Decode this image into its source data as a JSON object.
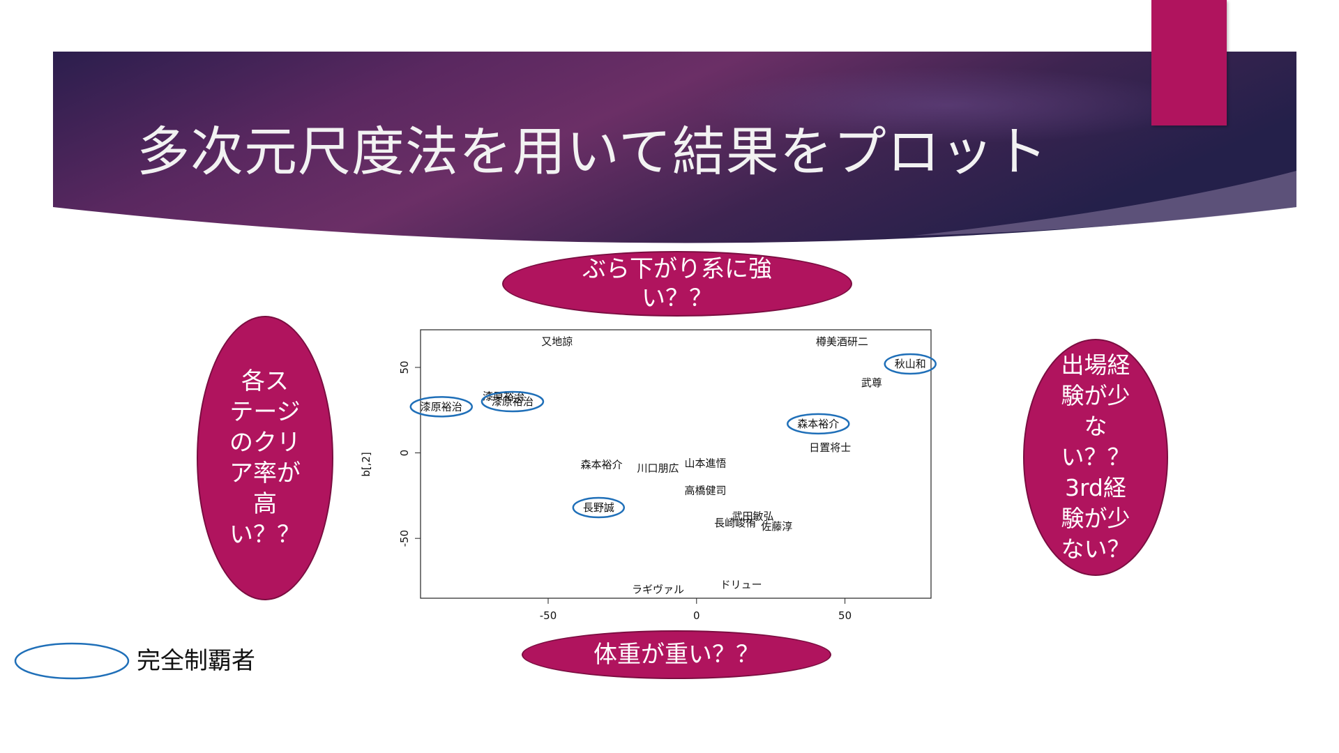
{
  "slide": {
    "title": "多次元尺度法を用いて結果をプロット",
    "colors": {
      "banner_dark": "#2a1f4a",
      "banner_mid": "#5c2a5e",
      "accent": "#b0145e",
      "legend_ring": "#1f6fb8"
    }
  },
  "bubbles": {
    "top": "ぶら下がり系に強\nい？？",
    "left": "各ス\nテージ\nのクリ\nア率が\n高\nい？？",
    "right": "出場経\n験が少\nな\nい？？\n3rd経\n験が少\nない？",
    "bottom": "体重が重い？？"
  },
  "legend": {
    "label": "完全制覇者"
  },
  "chart_data": {
    "type": "scatter",
    "xlabel": "",
    "ylabel": "b[,2]",
    "xlim": [
      -93,
      79
    ],
    "ylim": [
      -85,
      72
    ],
    "x_ticks": [
      "-50",
      "0",
      "50"
    ],
    "y_ticks": [
      "-50",
      "0",
      "50"
    ],
    "points": [
      {
        "label": "又地諒",
        "x": -47,
        "y": 65,
        "champion": false
      },
      {
        "label": "樽美酒研二",
        "x": 49,
        "y": 65,
        "champion": false
      },
      {
        "label": "秋山和",
        "x": 72,
        "y": 52,
        "champion": true
      },
      {
        "label": "武尊",
        "x": 59,
        "y": 41,
        "champion": false
      },
      {
        "label": "漆原裕治",
        "x": -86,
        "y": 27,
        "champion": true
      },
      {
        "label": "漆原裕治",
        "x": -65,
        "y": 33,
        "champion": false
      },
      {
        "label": "漆原裕治",
        "x": -62,
        "y": 30,
        "champion": true
      },
      {
        "label": "森本裕介",
        "x": 41,
        "y": 17,
        "champion": true
      },
      {
        "label": "日置将士",
        "x": 45,
        "y": 3,
        "champion": false
      },
      {
        "label": "森本裕介",
        "x": -32,
        "y": -7,
        "champion": false
      },
      {
        "label": "川口朋広",
        "x": -13,
        "y": -9,
        "champion": false
      },
      {
        "label": "山本進悟",
        "x": 3,
        "y": -6,
        "champion": false
      },
      {
        "label": "高橋健司",
        "x": 3,
        "y": -22,
        "champion": false
      },
      {
        "label": "長野誠",
        "x": -33,
        "y": -32,
        "champion": true
      },
      {
        "label": "武田敏弘",
        "x": 19,
        "y": -37,
        "champion": false
      },
      {
        "label": "長崎峻侑",
        "x": 13,
        "y": -41,
        "champion": false
      },
      {
        "label": "佐藤淳",
        "x": 27,
        "y": -43,
        "champion": false
      },
      {
        "label": "ドリュー",
        "x": 15,
        "y": -77,
        "champion": false
      },
      {
        "label": "ラギヴァル",
        "x": -13,
        "y": -80,
        "champion": false
      }
    ]
  }
}
